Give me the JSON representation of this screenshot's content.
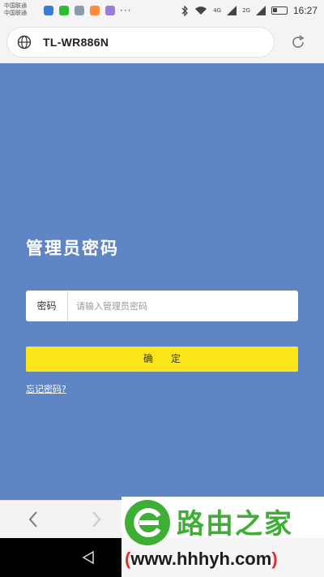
{
  "status_bar": {
    "carrier_line1": "中国联通",
    "carrier_line2": "中国联通",
    "more": "···",
    "net1": "4G",
    "net2": "2G",
    "time": "16:27",
    "app_icon_colors": [
      "#3a7bd5",
      "#2dbb2f",
      "#8a9bb0",
      "#ff8a3c",
      "#9b7be0"
    ]
  },
  "address_bar": {
    "url": "TL-WR886N",
    "globe_icon": "globe-icon",
    "reload_icon": "reload-icon"
  },
  "page": {
    "title": "管理员密码",
    "password_label": "密码",
    "password_placeholder": "请输入管理员密码",
    "confirm_button": "确定",
    "forgot_link": "忘记密码?"
  },
  "browser_nav": {
    "back_icon": "chevron-left-icon",
    "forward_icon": "chevron-right-icon"
  },
  "watermark": {
    "brand": "路由之家",
    "url_open": "(",
    "url": "www.hhhyh.com",
    "url_close": ")"
  },
  "colors": {
    "background": "#5f85c4",
    "button": "#fce61b",
    "watermark_green": "#3fae34"
  }
}
